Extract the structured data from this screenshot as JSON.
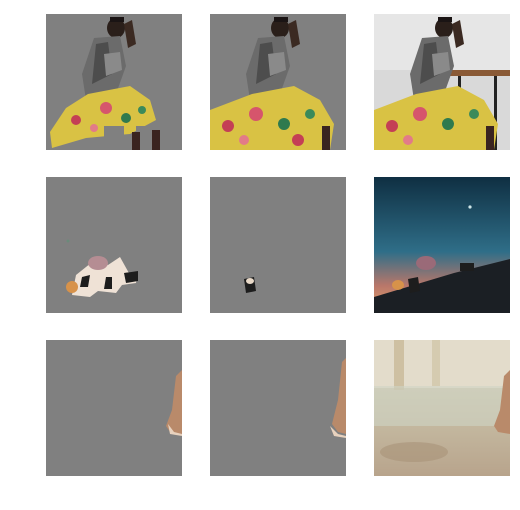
{
  "figure": {
    "rows": [
      {
        "name": "row-1",
        "tiles": [
          {
            "name": "woman-seated-masked-partial",
            "background": "#808080"
          },
          {
            "name": "woman-seated-masked-full",
            "background": "#808080"
          },
          {
            "name": "woman-seated-original",
            "background": "#e6e6e6"
          }
        ]
      },
      {
        "name": "row-2",
        "tiles": [
          {
            "name": "sky-scene-masked-large",
            "background": "#808080"
          },
          {
            "name": "sky-scene-masked-small",
            "background": "#808080"
          },
          {
            "name": "sky-scene-original",
            "background": "#1d4a60"
          }
        ]
      },
      {
        "name": "row-3",
        "tiles": [
          {
            "name": "foot-scene-masked-a",
            "background": "#808080"
          },
          {
            "name": "foot-scene-masked-b",
            "background": "#808080"
          },
          {
            "name": "foot-scene-original",
            "background": "#c9c1a8"
          }
        ]
      }
    ]
  }
}
